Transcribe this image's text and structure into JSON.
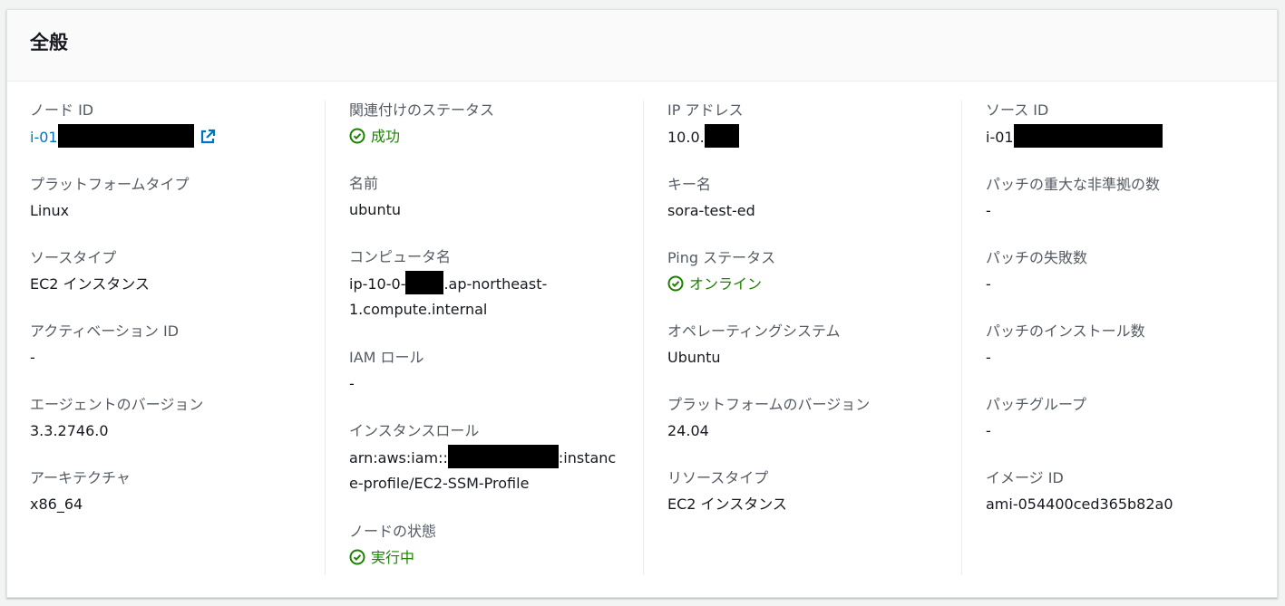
{
  "panel": {
    "title": "全般"
  },
  "col1": {
    "node_id": {
      "label": "ノード ID",
      "value_prefix": "i-01"
    },
    "platform_type": {
      "label": "プラットフォームタイプ",
      "value": "Linux"
    },
    "source_type": {
      "label": "ソースタイプ",
      "value": "EC2 インスタンス"
    },
    "activation_id": {
      "label": "アクティベーション ID",
      "value": "-"
    },
    "agent_version": {
      "label": "エージェントのバージョン",
      "value": "3.3.2746.0"
    },
    "architecture": {
      "label": "アーキテクチャ",
      "value": "x86_64"
    }
  },
  "col2": {
    "association_status": {
      "label": "関連付けのステータス",
      "value": "成功"
    },
    "name": {
      "label": "名前",
      "value": "ubuntu"
    },
    "computer_name": {
      "label": "コンピュータ名",
      "value_prefix": "ip-10-0-",
      "value_suffix": ".ap-northeast-1.compute.internal"
    },
    "iam_role": {
      "label": "IAM ロール",
      "value": "-"
    },
    "instance_role": {
      "label": "インスタンスロール",
      "value_prefix": "arn:aws:iam::",
      "value_suffix": ":instance-profile/EC2-SSM-Profile"
    },
    "node_state": {
      "label": "ノードの状態",
      "value": "実行中"
    }
  },
  "col3": {
    "ip_address": {
      "label": "IP アドレス",
      "value_prefix": "10.0."
    },
    "key_name": {
      "label": "キー名",
      "value": "sora-test-ed"
    },
    "ping_status": {
      "label": "Ping ステータス",
      "value": "オンライン"
    },
    "os": {
      "label": "オペレーティングシステム",
      "value": "Ubuntu"
    },
    "platform_version": {
      "label": "プラットフォームのバージョン",
      "value": "24.04"
    },
    "resource_type": {
      "label": "リソースタイプ",
      "value": "EC2 インスタンス"
    }
  },
  "col4": {
    "source_id": {
      "label": "ソース ID",
      "value_prefix": "i-01"
    },
    "patch_critical_noncompliant": {
      "label": "パッチの重大な非準拠の数",
      "value": "-"
    },
    "patch_failed": {
      "label": "パッチの失敗数",
      "value": "-"
    },
    "patch_installed": {
      "label": "パッチのインストール数",
      "value": "-"
    },
    "patch_group": {
      "label": "パッチグループ",
      "value": "-"
    },
    "image_id": {
      "label": "イメージ ID",
      "value": "ami-054400ced365b82a0"
    }
  },
  "icons": {
    "external_link": "external-link-icon",
    "status_success": "check-circle-icon"
  },
  "colors": {
    "link": "#0073bb",
    "success": "#1d8102",
    "label": "#545b64",
    "text": "#16191f"
  }
}
